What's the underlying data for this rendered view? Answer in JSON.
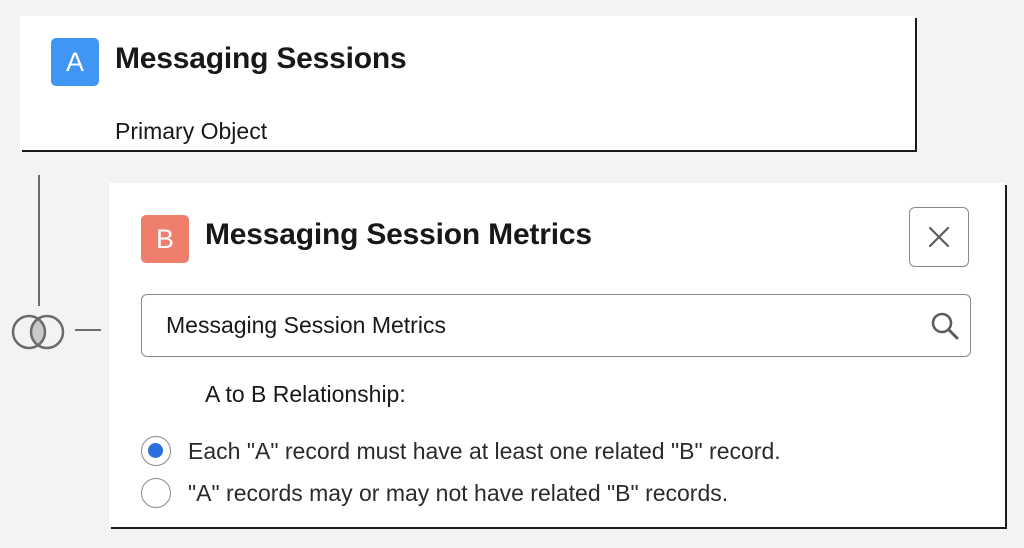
{
  "primary": {
    "badge": "A",
    "badge_color": "#4096f2",
    "title": "Messaging Sessions",
    "subtitle": "Primary Object"
  },
  "related": {
    "badge": "B",
    "badge_color": "#ef7e6d",
    "title": "Messaging Session Metrics",
    "search_value": "Messaging Session Metrics",
    "close_icon": "close-icon",
    "search_icon": "search-icon",
    "relationship_label": "A to B Relationship:",
    "options": [
      {
        "label": "Each \"A\" record must have at least one related \"B\" record.",
        "selected": true
      },
      {
        "label": "\"A\" records may or may not have related \"B\" records.",
        "selected": false
      }
    ],
    "accent_color": "#2a6ee0"
  },
  "connector": {
    "icon": "venn-join-icon"
  }
}
